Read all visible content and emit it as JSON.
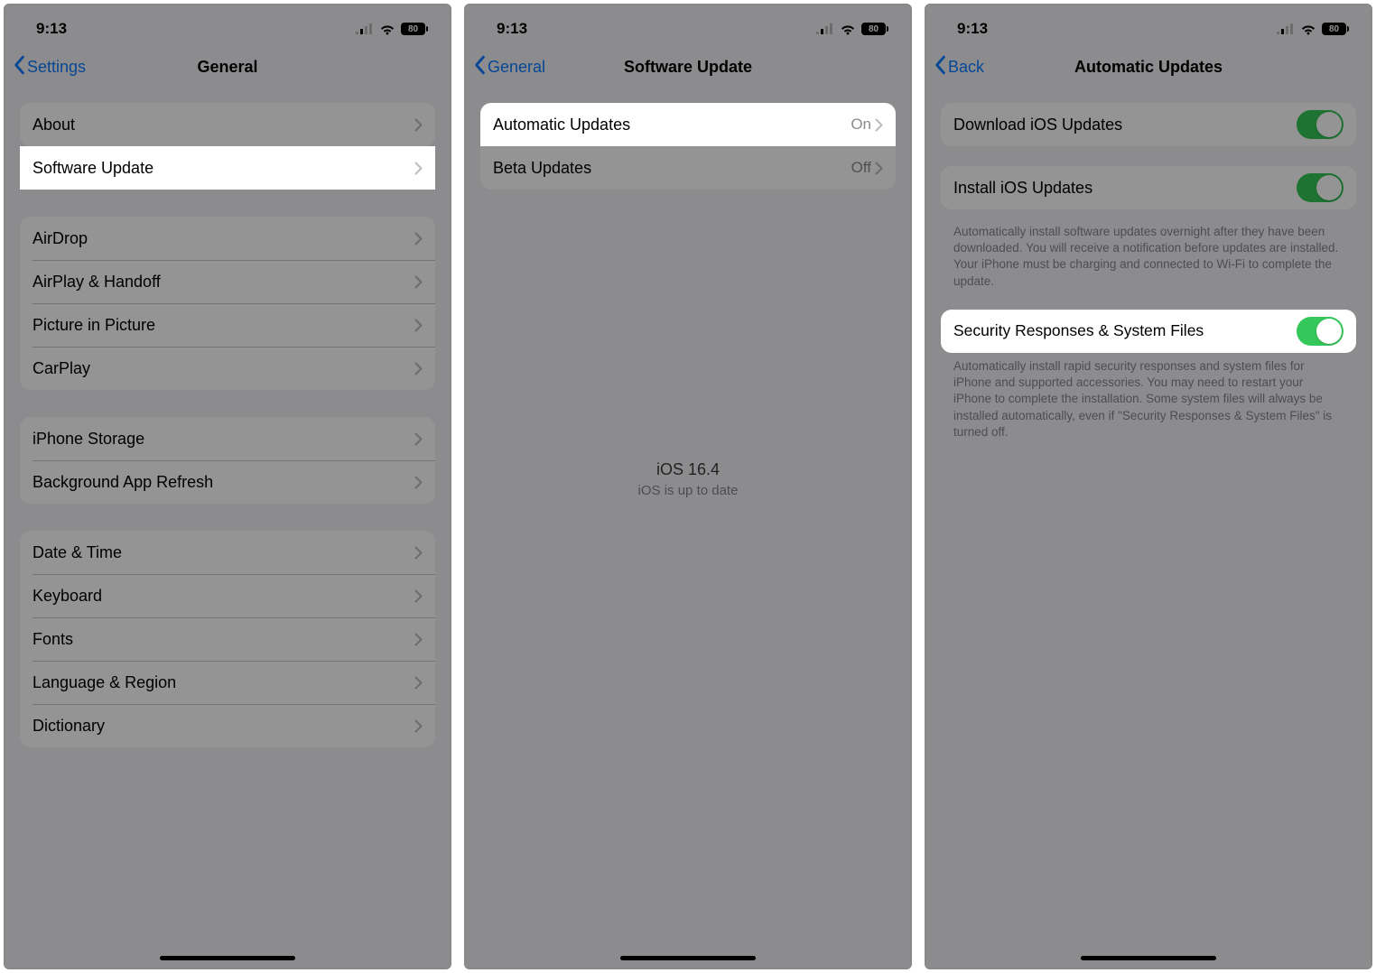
{
  "status": {
    "time": "9:13",
    "battery": "80"
  },
  "screen1": {
    "back": "Settings",
    "title": "General",
    "group1": [
      "About",
      "Software Update"
    ],
    "group2": [
      "AirDrop",
      "AirPlay & Handoff",
      "Picture in Picture",
      "CarPlay"
    ],
    "group3": [
      "iPhone Storage",
      "Background App Refresh"
    ],
    "group4": [
      "Date & Time",
      "Keyboard",
      "Fonts",
      "Language & Region",
      "Dictionary"
    ]
  },
  "screen2": {
    "back": "General",
    "title": "Software Update",
    "rows": [
      {
        "label": "Automatic Updates",
        "value": "On"
      },
      {
        "label": "Beta Updates",
        "value": "Off"
      }
    ],
    "version": "iOS 16.4",
    "status_msg": "iOS is up to date"
  },
  "screen3": {
    "back": "Back",
    "title": "Automatic Updates",
    "row1": "Download iOS Updates",
    "row2": "Install iOS Updates",
    "footer2": "Automatically install software updates overnight after they have been downloaded. You will receive a notification before updates are installed. Your iPhone must be charging and connected to Wi-Fi to complete the update.",
    "row3": "Security Responses & System Files",
    "footer3": "Automatically install rapid security responses and system files for iPhone and supported accessories. You may need to restart your iPhone to complete the installation. Some system files will always be installed automatically, even if \"Security Responses & System Files\" is turned off."
  }
}
